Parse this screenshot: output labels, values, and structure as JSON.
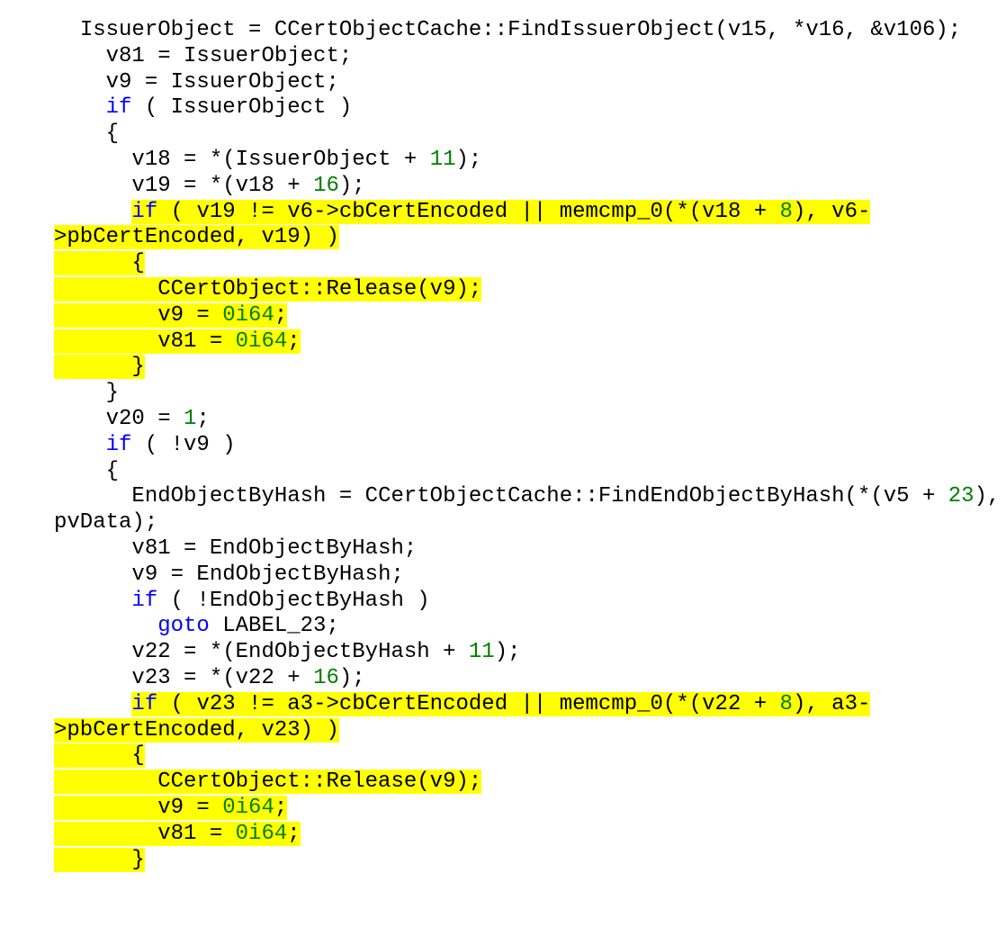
{
  "tokens": [
    {
      "t": "IssuerObject = CCertObjectCache::FindIssuerObject(v15, *v16, &v106);",
      "nl": true,
      "indent": 1
    },
    {
      "t": "v81 = IssuerObject;",
      "nl": true,
      "indent": 2
    },
    {
      "t": "v9 = IssuerObject;",
      "nl": true,
      "indent": 2
    },
    {
      "t": "if",
      "cls": "kw",
      "indent": 2
    },
    {
      "t": " ( IssuerObject )",
      "nl": true
    },
    {
      "t": "{",
      "nl": true,
      "indent": 2
    },
    {
      "t": "v18 = *(IssuerObject + ",
      "indent": 3
    },
    {
      "t": "11",
      "cls": "num"
    },
    {
      "t": ");",
      "nl": true
    },
    {
      "t": "v19 = *(v18 + ",
      "indent": 3
    },
    {
      "t": "16",
      "cls": "num"
    },
    {
      "t": ");",
      "nl": true
    },
    {
      "t": "      ",
      "raw": true
    },
    {
      "t": "if",
      "cls": "kw hl"
    },
    {
      "t": " ( v19 != v6->cbCertEncoded || memcmp_0(*(v18 + ",
      "cls": "hl"
    },
    {
      "t": "8",
      "cls": "num hl"
    },
    {
      "t": "), v6-",
      "cls": "hl",
      "nl": true
    },
    {
      "t": ">pbCertEncoded, v19) )",
      "cls": "hl",
      "nl": true,
      "indent": 0
    },
    {
      "t": "      {",
      "cls": "hl",
      "nl": true,
      "raw": true
    },
    {
      "t": "        CCertObject::Release(v9);",
      "cls": "hl",
      "nl": true,
      "raw": true
    },
    {
      "t": "        v9 = ",
      "cls": "hl",
      "raw": true
    },
    {
      "t": "0i64",
      "cls": "num hl"
    },
    {
      "t": ";",
      "cls": "hl",
      "nl": true
    },
    {
      "t": "        v81 = ",
      "cls": "hl",
      "raw": true
    },
    {
      "t": "0i64",
      "cls": "num hl"
    },
    {
      "t": ";",
      "cls": "hl",
      "nl": true
    },
    {
      "t": "      }",
      "cls": "hl",
      "nl": true,
      "raw": true
    },
    {
      "t": "}",
      "nl": true,
      "indent": 2
    },
    {
      "t": "v20 = ",
      "indent": 2
    },
    {
      "t": "1",
      "cls": "num"
    },
    {
      "t": ";",
      "nl": true
    },
    {
      "t": "if",
      "cls": "kw",
      "indent": 2
    },
    {
      "t": " ( !v9 )",
      "nl": true
    },
    {
      "t": "{",
      "nl": true,
      "indent": 2
    },
    {
      "t": "EndObjectByHash = CCertObjectCache::FindEndObjectByHash(*(v5 + ",
      "indent": 3
    },
    {
      "t": "23",
      "cls": "num"
    },
    {
      "t": "), ",
      "nl": true
    },
    {
      "t": "pvData);",
      "nl": true,
      "indent": 0
    },
    {
      "t": "v81 = EndObjectByHash;",
      "nl": true,
      "indent": 3
    },
    {
      "t": "v9 = EndObjectByHash;",
      "nl": true,
      "indent": 3
    },
    {
      "t": "if",
      "cls": "kw",
      "indent": 3
    },
    {
      "t": " ( !EndObjectByHash )",
      "nl": true
    },
    {
      "t": "goto",
      "cls": "kw",
      "indent": 4
    },
    {
      "t": " LABEL_23;",
      "nl": true
    },
    {
      "t": "v22 = *(EndObjectByHash + ",
      "indent": 3
    },
    {
      "t": "11",
      "cls": "num"
    },
    {
      "t": ");",
      "nl": true
    },
    {
      "t": "v23 = *(v22 + ",
      "indent": 3
    },
    {
      "t": "16",
      "cls": "num"
    },
    {
      "t": ");",
      "nl": true
    },
    {
      "t": "      ",
      "raw": true
    },
    {
      "t": "if",
      "cls": "kw hl"
    },
    {
      "t": " ( v23 != a3->cbCertEncoded || memcmp_0(*(v22 + ",
      "cls": "hl"
    },
    {
      "t": "8",
      "cls": "num hl"
    },
    {
      "t": "), a3-",
      "cls": "hl",
      "nl": true
    },
    {
      "t": ">pbCertEncoded, v23) )",
      "cls": "hl",
      "nl": true,
      "indent": 0
    },
    {
      "t": "      {",
      "cls": "hl",
      "nl": true,
      "raw": true
    },
    {
      "t": "        CCertObject::Release(v9);",
      "cls": "hl",
      "nl": true,
      "raw": true
    },
    {
      "t": "        v9 = ",
      "cls": "hl",
      "raw": true
    },
    {
      "t": "0i64",
      "cls": "num hl"
    },
    {
      "t": ";",
      "cls": "hl",
      "nl": true
    },
    {
      "t": "        v81 = ",
      "cls": "hl",
      "raw": true
    },
    {
      "t": "0i64",
      "cls": "num hl"
    },
    {
      "t": ";",
      "cls": "hl",
      "nl": true
    },
    {
      "t": "      }",
      "cls": "hl",
      "nl": true,
      "raw": true
    }
  ]
}
